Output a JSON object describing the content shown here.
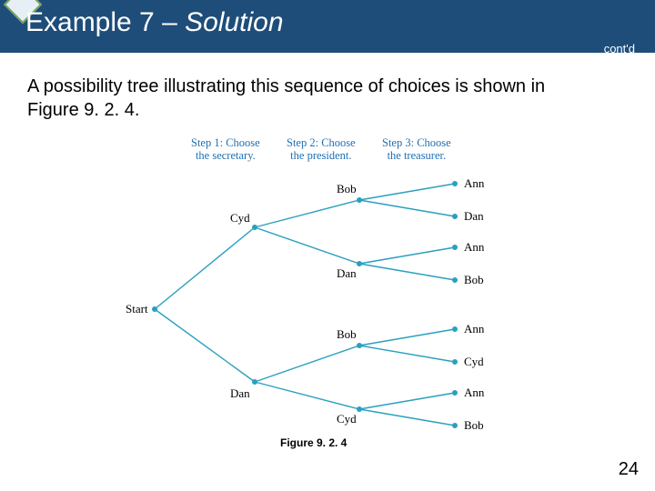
{
  "header": {
    "title_prefix": "Example 7 – ",
    "title_emph": "Solution",
    "contd": "cont'd"
  },
  "body": {
    "text": "A possibility tree illustrating this sequence of choices is shown in Figure 9. 2. 4."
  },
  "steps": {
    "s1": "Step 1: Choose\nthe secretary.",
    "s2": "Step 2: Choose\nthe president.",
    "s3": "Step 3: Choose\nthe treasurer."
  },
  "nodes": {
    "start": "Start",
    "cyd": "Cyd",
    "dan": "Dan",
    "bob": "Bob",
    "ann": "Ann"
  },
  "caption": "Figure 9. 2. 4",
  "page": "24",
  "chart_data": {
    "type": "tree",
    "title": "Possibility tree for Example 7",
    "figure_ref": "9.2.4",
    "steps": [
      "Step 1: Choose the secretary.",
      "Step 2: Choose the president.",
      "Step 3: Choose the treasurer."
    ],
    "root": "Start",
    "paths": [
      [
        "Cyd",
        "Bob",
        "Ann"
      ],
      [
        "Cyd",
        "Bob",
        "Dan"
      ],
      [
        "Cyd",
        "Dan",
        "Ann"
      ],
      [
        "Cyd",
        "Dan",
        "Bob"
      ],
      [
        "Dan",
        "Bob",
        "Ann"
      ],
      [
        "Dan",
        "Bob",
        "Cyd"
      ],
      [
        "Dan",
        "Cyd",
        "Ann"
      ],
      [
        "Dan",
        "Cyd",
        "Bob"
      ]
    ]
  }
}
